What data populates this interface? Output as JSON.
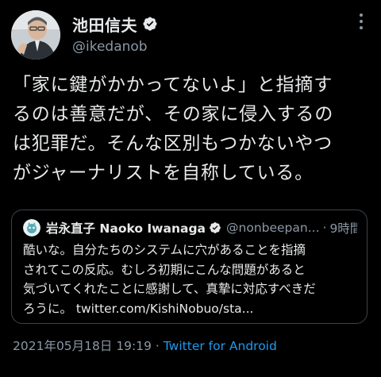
{
  "colors": {
    "background": "#000000",
    "text": "#e7e9ea",
    "secondary": "#8b98a5",
    "accent": "#1d9bf0",
    "border": "#3d4348"
  },
  "author": {
    "display_name": "池田信夫",
    "handle": "@ikedanob",
    "verified": true,
    "avatar_icon": "avatar"
  },
  "tweet": {
    "lines": [
      "「家に鍵がかかってないよ」と指摘す",
      "るのは善意だが、その家に侵入するの",
      "は犯罪だ。そんな区別もつかないやつ",
      "がジャーナリストを自称している。"
    ]
  },
  "quoted": {
    "display_name": "岩永直子 Naoko Iwanaga",
    "handle": "@nonbeepan...",
    "separator": "·",
    "time": "9時間",
    "verified": true,
    "lines": [
      "酷いな。自分たちのシステムに穴があることを指摘",
      "されてこの反応。むしろ初期にこんな問題があると",
      "気づいてくれたことに感謝して、真摯に対応すべきだ",
      "ろうに。 twitter.com/KishiNobuo/sta..."
    ]
  },
  "meta": {
    "timestamp": "2021年05月18日 19:19",
    "separator": " · ",
    "source": "Twitter for Android"
  }
}
